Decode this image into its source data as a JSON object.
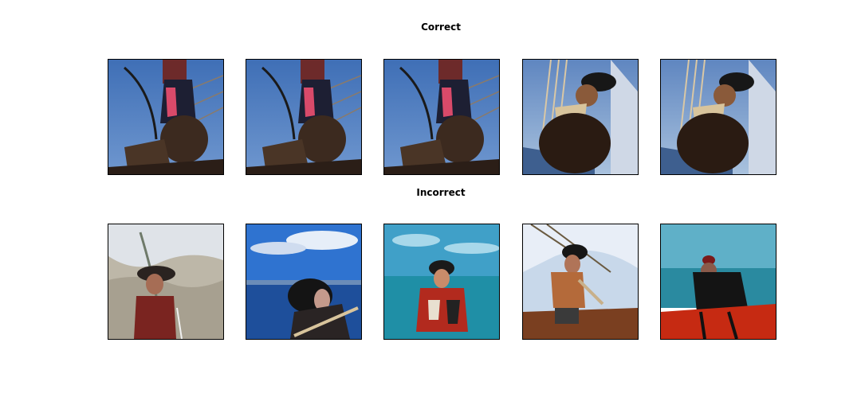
{
  "figure": {
    "correct_title": "Correct",
    "incorrect_title": "Incorrect",
    "correct_images": [
      {
        "icon": "pirate-archer-sky-image"
      },
      {
        "icon": "pirate-archer-sky-image"
      },
      {
        "icon": "pirate-archer-sky-image"
      },
      {
        "icon": "pirate-ship-rigging-image"
      },
      {
        "icon": "pirate-ship-rigging-image"
      }
    ],
    "incorrect_images": [
      {
        "icon": "pirate-on-beach-image"
      },
      {
        "icon": "pirate-sea-sky-image"
      },
      {
        "icon": "pirate-red-cloak-sea-image"
      },
      {
        "icon": "pirate-ship-deck-image"
      },
      {
        "icon": "pirate-red-deck-image"
      }
    ],
    "colors": {
      "text": "#000000",
      "background": "#ffffff"
    }
  }
}
